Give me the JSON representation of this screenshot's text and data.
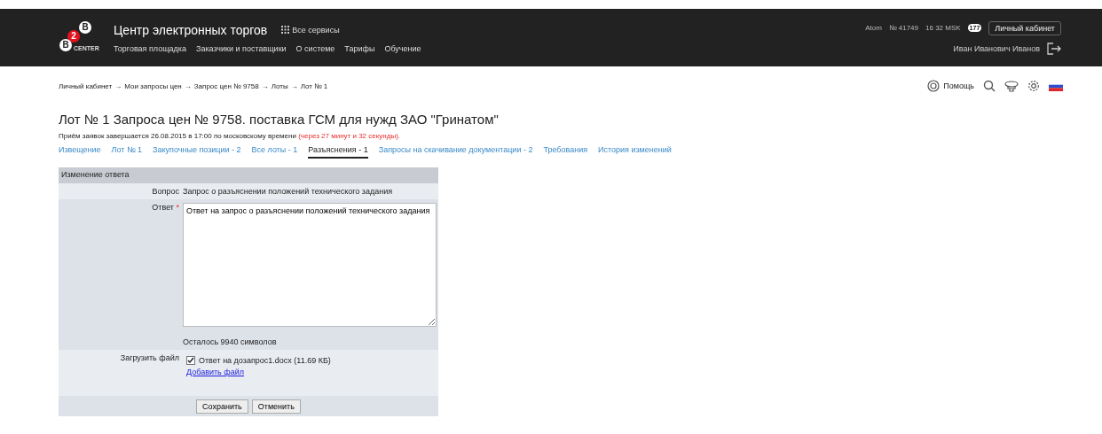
{
  "header": {
    "logo": {
      "top": "B",
      "middle": "2",
      "left": "B",
      "caption": "CENTER"
    },
    "site_title": "Центр электронных торгов",
    "services_link": "Все сервисы",
    "nav": [
      "Торговая площадка",
      "Заказчики и поставщики",
      "О системе",
      "Тарифы",
      "Обучение"
    ],
    "status": [
      "Atom",
      "№ 41749",
      "16 32 MSK"
    ],
    "messages_count": "177",
    "account_button": "Личный кабинет",
    "user_name": "Иван Иванович Иванов"
  },
  "breadcrumbs": [
    "Личный кабинет",
    "Мои запросы цен",
    "Запрос цен № 9758",
    "Лоты",
    "Лот № 1"
  ],
  "breadcrumb_separator": "→",
  "help_link": "Помощь",
  "title": "Лот № 1 Запроса цен № 9758. поставка ГСМ для нужд ЗАО \"Гринатом\"",
  "deadline": {
    "text": "Приём заявок завершается 26.08.2015 в 17:00 по московскому времени",
    "remaining": "(через 27 минут и 32 секунды)."
  },
  "tabs": [
    {
      "label": "Извещение",
      "selected": false
    },
    {
      "label": "Лот № 1",
      "selected": false
    },
    {
      "label": "Закупочные позиции - 2",
      "selected": false
    },
    {
      "label": "Все лоты - 1",
      "selected": false
    },
    {
      "label": "Разъяснения - 1",
      "selected": true
    },
    {
      "label": "Запросы на скачивание документации - 2",
      "selected": false
    },
    {
      "label": "Требования",
      "selected": false
    },
    {
      "label": "История изменений",
      "selected": false
    }
  ],
  "form": {
    "title": "Изменение ответа",
    "question_label": "Вопрос",
    "question": "Запрос о разъяснении положений технического задания",
    "answer_label": "Ответ",
    "required_mark": "*",
    "answer": "Ответ на запрос о разъяснении положений технического задания",
    "chars_left": "Осталось 9940 символов",
    "file_label": "Загрузить файл",
    "files": [
      {
        "name": "Ответ на дозапрос1.docx (11.69 КБ)",
        "checked": true
      }
    ],
    "add_file": "Добавить файл",
    "buttons": [
      "Сохранить",
      "Отменить"
    ]
  }
}
